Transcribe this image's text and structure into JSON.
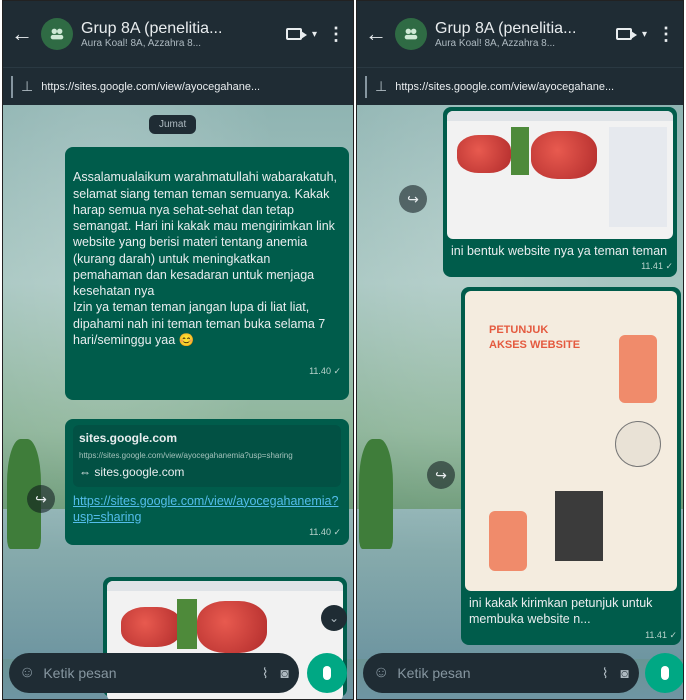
{
  "header": {
    "group_name": "Grup 8A (penelitia...",
    "group_sub_left": "Aura Koal! 8A, Azzahra 8...",
    "group_sub_right": "Aura Koal! 8A, Azzahra 8..."
  },
  "pinned": {
    "url_left": "https://sites.google.com/view/ayocegahane...",
    "url_right": "https://sites.google.com/view/ayocegahane..."
  },
  "chat_left": {
    "day_chip": "Jumat",
    "message1": "Assalamualaikum warahmatullahi wabarakatuh, selamat siang teman teman semuanya. Kakak harap semua nya sehat-sehat dan tetap semangat. Hari ini kakak mau mengirimkan link website yang berisi materi tentang anemia (kurang darah) untuk meningkatkan pemahaman dan kesadaran untuk menjaga kesehatan nya\nIzin ya teman teman jangan lupa di liat liat, dipahami nah ini teman teman buka selama 7 hari/seminggu yaa 😊",
    "message1_time": "11.40 ✓",
    "link_title": "sites.google.com",
    "link_desc": "https://sites.google.com/view/ayocegahanemia?usp=sharing",
    "link_domain": "⇔ sites.google.com",
    "link_url": "https://sites.google.com/view/ayocegahanemia?usp=sharing",
    "link_time": "11.40 ✓"
  },
  "chat_right": {
    "img1_caption": "ini bentuk website nya ya teman teman",
    "img1_time": "11.41 ✓",
    "poster_title_line1": "PETUNJUK",
    "poster_title_line2": "AKSES WEBSITE",
    "img2_caption": "ini kakak kirimkan petunjuk untuk membuka website n...",
    "img2_time": "11.41 ✓"
  },
  "input": {
    "placeholder": "Ketik pesan"
  },
  "icons": {
    "back": "back-arrow-icon",
    "video": "video-call-icon",
    "menu": "more-options-icon",
    "pin": "pin-icon",
    "forward": "forward-icon",
    "emoji": "emoji-icon",
    "attach": "attach-icon",
    "camera": "camera-icon",
    "mic": "mic-icon"
  }
}
